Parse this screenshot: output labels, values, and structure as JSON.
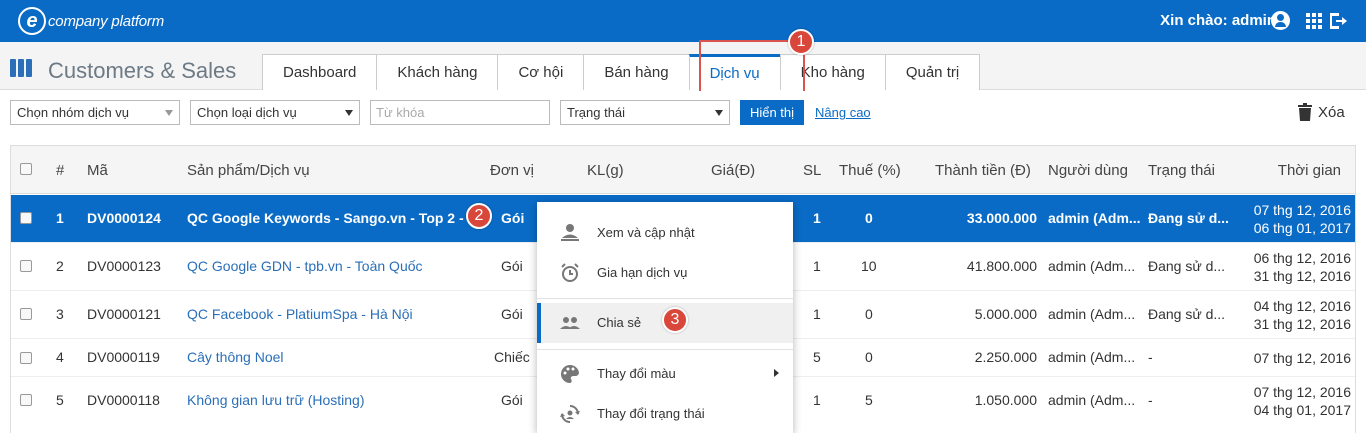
{
  "header": {
    "logo_letter": "e",
    "logo_text": "company platform",
    "greeting": "Xin chào: admin",
    "icons": [
      "user-icon",
      "apps-grid-icon",
      "logout-icon"
    ]
  },
  "module": {
    "title": "Customers & Sales",
    "tabs": [
      {
        "label": "Dashboard"
      },
      {
        "label": "Khách hàng"
      },
      {
        "label": "Cơ hội"
      },
      {
        "label": "Bán hàng"
      },
      {
        "label": "Dịch vụ",
        "active": true
      },
      {
        "label": "Kho hàng"
      },
      {
        "label": "Quản trị"
      }
    ]
  },
  "filters": {
    "service_group": "Chọn nhóm dịch vụ",
    "service_type": "Chọn loại dịch vụ",
    "keyword_placeholder": "Từ khóa",
    "status": "Trạng thái",
    "show_button": "Hiển thị",
    "advanced_link": "Nâng cao",
    "delete_label": "Xóa"
  },
  "table": {
    "columns": [
      "#",
      "Mã",
      "Sản phẩm/Dịch vụ",
      "Đơn vị",
      "KL(g)",
      "Giá(Đ)",
      "SL",
      "Thuế (%)",
      "Thành tiền (Đ)",
      "Người dùng",
      "Trạng thái",
      "Thời gian"
    ],
    "rows": [
      {
        "num": "1",
        "code": "DV0000124",
        "product": "QC Google Keywords - Sango.vn - Top 2 - T...",
        "unit": "Gói",
        "qty": "1",
        "tax": "0",
        "total": "33.000.000",
        "user": "admin (Adm...",
        "status": "Đang sử d...",
        "time1": "07 thg 12, 2016",
        "time2": "06 thg 01, 2017",
        "selected": true
      },
      {
        "num": "2",
        "code": "DV0000123",
        "product": "QC Google GDN - tpb.vn - Toàn Quốc",
        "unit": "Gói",
        "qty": "1",
        "tax": "10",
        "total": "41.800.000",
        "user": "admin (Adm...",
        "status": "Đang sử d...",
        "time1": "06 thg 12, 2016",
        "time2": "31 thg 12, 2016"
      },
      {
        "num": "3",
        "code": "DV0000121",
        "product": "QC Facebook - PlatiumSpa - Hà Nội",
        "unit": "Gói",
        "qty": "1",
        "tax": "0",
        "total": "5.000.000",
        "user": "admin (Adm...",
        "status": "Đang sử d...",
        "time1": "04 thg 12, 2016",
        "time2": "31 thg 12, 2016"
      },
      {
        "num": "4",
        "code": "DV0000119",
        "product": "Cây thông Noel",
        "unit": "Chiếc",
        "qty": "5",
        "tax": "0",
        "total": "2.250.000",
        "user": "admin (Adm...",
        "status": "-",
        "time1": "07 thg 12, 2016",
        "time2": ""
      },
      {
        "num": "5",
        "code": "DV0000118",
        "product": "Không gian lưu trữ (Hosting)",
        "unit": "Gói",
        "qty": "1",
        "tax": "5",
        "total": "1.050.000",
        "user": "admin (Adm...",
        "status": "-",
        "time1": "07 thg 12, 2016",
        "time2": "04 thg 01, 2017"
      }
    ]
  },
  "context_menu": {
    "items": [
      {
        "label": "Xem và cập nhật",
        "icon": "person-edit-icon"
      },
      {
        "label": "Gia hạn dịch vụ",
        "icon": "alarm-clock-icon"
      },
      {
        "label": "Chia sẻ",
        "icon": "people-icon",
        "hover": true
      },
      {
        "label": "Thay đổi màu",
        "icon": "palette-icon",
        "submenu": true
      },
      {
        "label": "Thay đổi trạng thái",
        "icon": "status-change-icon"
      }
    ]
  },
  "annotations": [
    "1",
    "2",
    "3"
  ],
  "colors": {
    "primary": "#0a6bc6",
    "annotation": "#d9463a",
    "row_link": "#2a6fb8"
  }
}
